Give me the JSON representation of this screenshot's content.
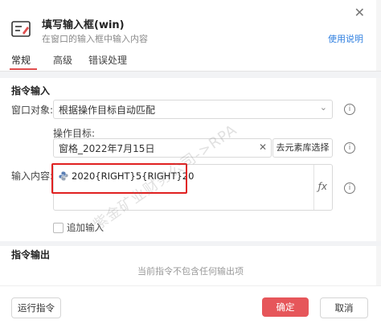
{
  "window": {
    "title": "填写输入框(win)",
    "subtitle": "在窗口的输入框中输入内容",
    "help_link": "使用说明",
    "close": "✕"
  },
  "tabs": [
    {
      "label": "常规",
      "active": true
    },
    {
      "label": "高级",
      "active": false
    },
    {
      "label": "错误处理",
      "active": false
    }
  ],
  "sections": {
    "input_title": "指令输入",
    "output_title": "指令输出"
  },
  "fields": {
    "window_object_label": "窗口对象:",
    "window_object_value": "根据操作目标自动匹配",
    "operation_target_label": "操作目标:",
    "operation_target_value": "窗格_2022年7月15日",
    "clear_symbol": "✕",
    "lib_select_button": "去元素库选择",
    "input_content_label": "输入内容:",
    "input_content_value": "2020{RIGHT}5{RIGHT}20",
    "fx_symbol": "ƒx",
    "append_input_label": "追加输入"
  },
  "output": {
    "empty_text": "当前指令不包含任何输出项"
  },
  "footer": {
    "run_button": "运行指令",
    "ok_button": "确定",
    "cancel_button": "取消"
  },
  "watermark": "紫金矿业财务公司->RPA",
  "colors": {
    "accent": "#e6565a",
    "link": "#2f7fe0",
    "highlight": "#e02020"
  }
}
